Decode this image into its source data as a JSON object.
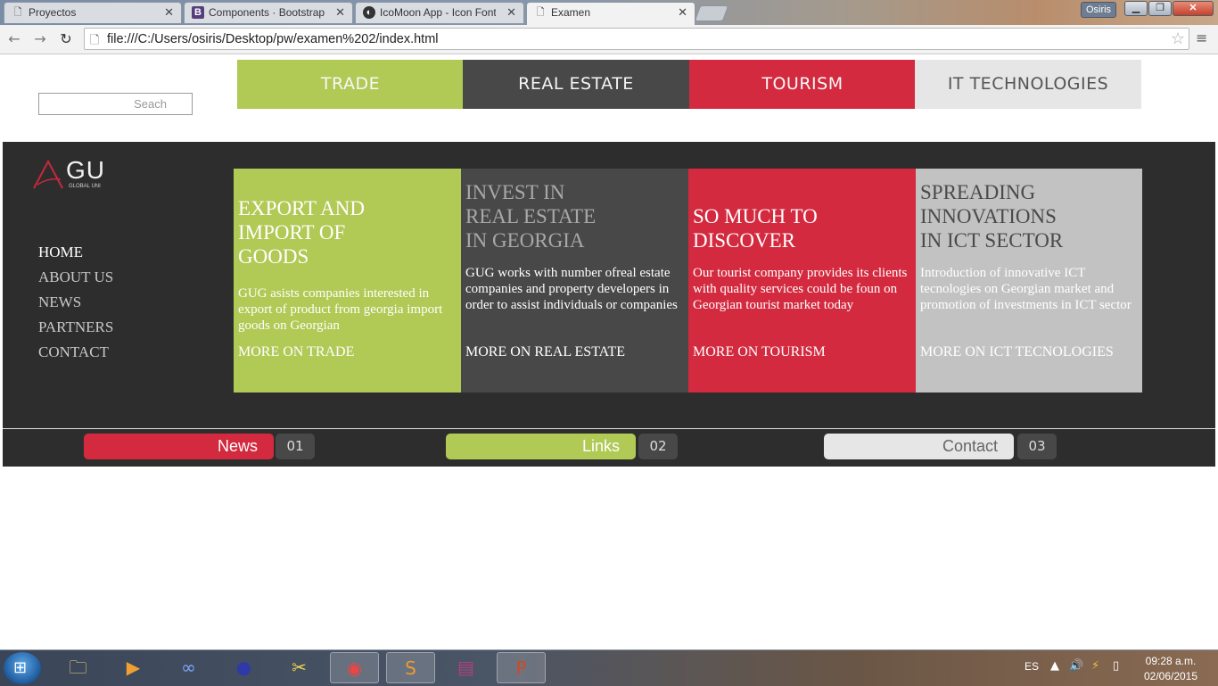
{
  "browser": {
    "tabs": [
      {
        "label": "Proyectos",
        "favicon": "page-icon"
      },
      {
        "label": "Components · Bootstrap",
        "favicon": "bootstrap-icon"
      },
      {
        "label": "IcoMoon App - Icon Font,",
        "favicon": "icomoon-icon"
      },
      {
        "label": "Examen",
        "favicon": "page-icon",
        "active": true
      }
    ],
    "user": "Osiris",
    "url": "file:///C:/Users/osiris/Desktop/pw/examen%202/index.html"
  },
  "site": {
    "search": {
      "placeholder": "Seach",
      "value": ""
    },
    "top_nav": [
      {
        "label": "TRADE",
        "color": "#b1c955"
      },
      {
        "label": "REAL ESTATE",
        "color": "#484848"
      },
      {
        "label": "TOURISM",
        "color": "#d32a3f"
      },
      {
        "label": "IT TECHNOLOGIES",
        "color": "#e6e6e6"
      }
    ],
    "logo": {
      "text": "GU",
      "subtext": "GLOBAL UNI"
    },
    "side_nav": [
      {
        "label": "HOME",
        "active": true
      },
      {
        "label": "ABOUT US"
      },
      {
        "label": "NEWS"
      },
      {
        "label": "PARTNERS"
      },
      {
        "label": "CONTACT"
      }
    ],
    "panels": [
      {
        "title": [
          "EXPORT AND",
          "IMPORT OF",
          "GOODS"
        ],
        "text": "GUG asists companies interested in export of product from georgia import goods on Georgian",
        "more": "MORE ON TRADE"
      },
      {
        "title": [
          "INVEST IN",
          "REAL ESTATE",
          "IN GEORGIA"
        ],
        "text": "GUG works with number ofreal estate companies and property developers in order to assist individuals or companies",
        "more": "MORE ON REAL ESTATE"
      },
      {
        "title": [
          "SO MUCH TO",
          "DISCOVER"
        ],
        "text": "Our tourist company provides its clients with quality services could be foun on Georgian tourist market today",
        "more": "MORE ON TOURISM"
      },
      {
        "title": [
          "SPREADING",
          "INNOVATIONS",
          "IN ICT SECTOR"
        ],
        "text": "Introduction of innovative ICT tecnologies on Georgian market and promotion of investments in ICT sector",
        "more": "MORE ON ICT TECNOLOGIES"
      }
    ],
    "bottom_bar": [
      {
        "label": "News",
        "number": "01"
      },
      {
        "label": "Links",
        "number": "02"
      },
      {
        "label": "Contact",
        "number": "03"
      }
    ]
  },
  "taskbar": {
    "language": "ES",
    "time": "09:28 a.m.",
    "date": "02/06/2015"
  }
}
